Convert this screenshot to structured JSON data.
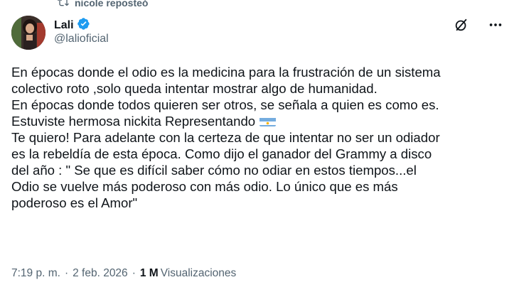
{
  "repost": {
    "text": "nicole reposteó",
    "icon": "repost-icon"
  },
  "author": {
    "name": "Lali",
    "handle": "@lalioficial",
    "verified": true,
    "verified_color": "#1d9bf0"
  },
  "actions": {
    "grok_icon": "grok-icon",
    "more_icon": "more-icon"
  },
  "tweet": {
    "text_part1": "En épocas donde el odio es la medicina para la frustración de un sistema\ncolectivo roto ,solo queda intentar mostrar algo de humanidad.\nEn épocas donde todos quieren ser otros, se señala a quien es como es.\nEstuviste hermosa nickita Representando",
    "flag": "argentina-flag-icon",
    "text_part2": "\nTe quiero! Para adelante con la certeza de que intentar no ser un odiador\nes la rebeldía de esta época. Como dijo el ganador del Grammy a disco\ndel año : \" Se que es difícil saber cómo no odiar en estos tiempos...el\nOdio se vuelve más poderoso con más odio. Lo único que es más\npoderoso es el Amor\""
  },
  "meta": {
    "time": "7:19 p. m.",
    "date": "2 feb. 2026",
    "separator": "·",
    "views_count": "1 M",
    "views_label": "Visualizaciones"
  }
}
